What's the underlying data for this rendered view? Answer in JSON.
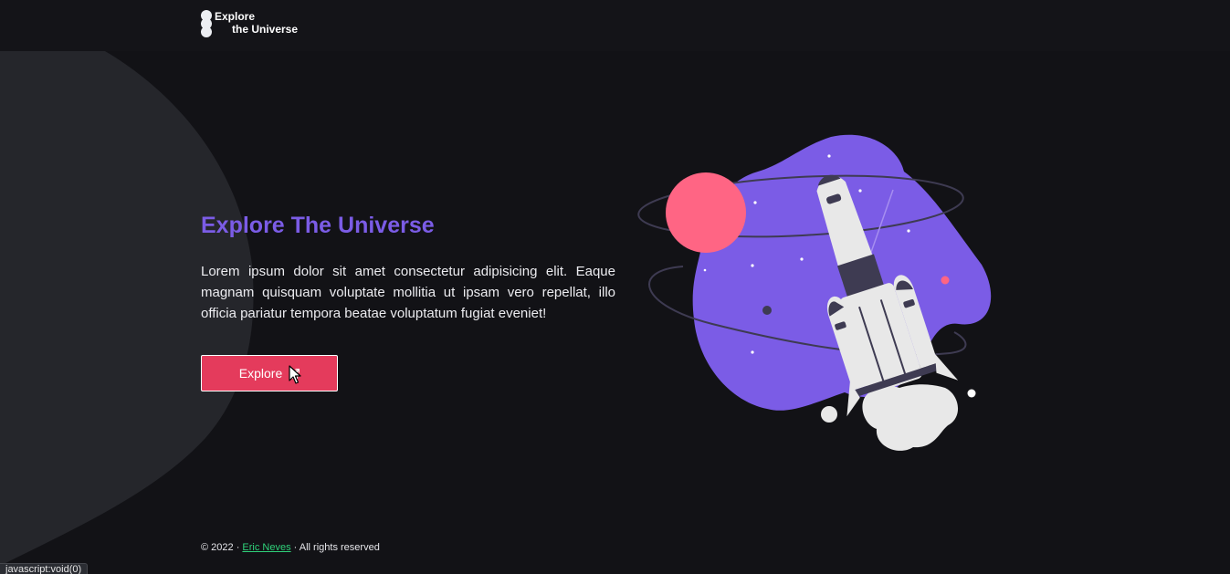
{
  "header": {
    "logo_line1": "Explore",
    "logo_line2": "the Universe"
  },
  "hero": {
    "title": "Explore The Universe",
    "text": "Lorem ipsum dolor sit amet consectetur adipisicing elit. Eaque magnam quisquam voluptate mollitia ut ipsam vero repellat, illo officia pariatur tempora beatae voluptatum fugiat eveniet!",
    "button_label": "Explore",
    "button_icon": "external-link-icon"
  },
  "footer": {
    "prefix": "© 2022 · ",
    "author": "Eric Neves",
    "suffix": " · All rights reserved"
  },
  "status_bar": {
    "text": "javascript:void(0)"
  },
  "colors": {
    "background": "#121216",
    "accent_purple": "#7b5ce6",
    "button_red": "#e43b5c",
    "planet_pink": "#ff6584",
    "link_green": "#2fd27a"
  }
}
